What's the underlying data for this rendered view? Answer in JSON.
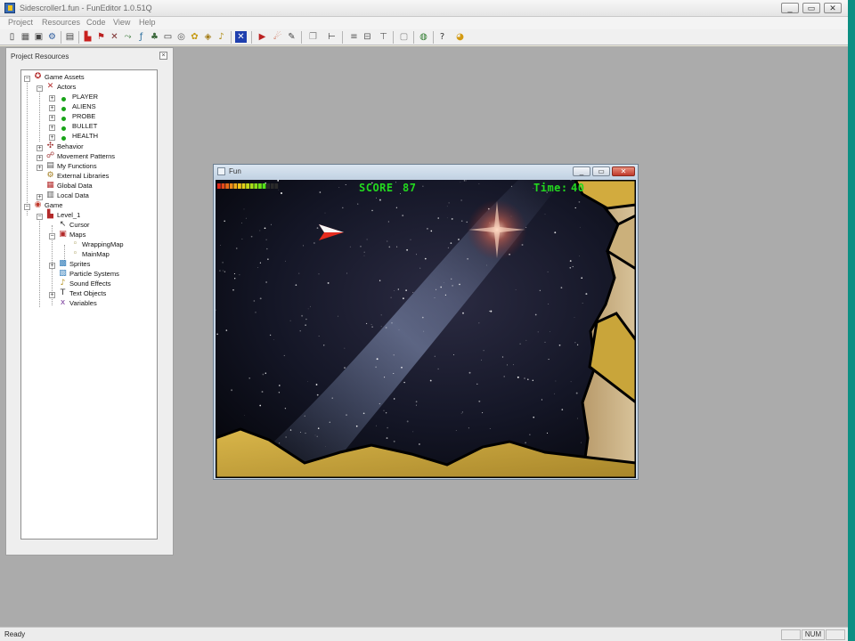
{
  "window": {
    "title": "Sidescroller1.fun - FunEditor 1.0.51Q",
    "buttons": {
      "minimize": "_",
      "maximize": "▭",
      "close": "✕"
    }
  },
  "menu": [
    "Project",
    "Resources",
    "Code",
    "View",
    "Help"
  ],
  "panel": {
    "title": "Project Resources",
    "close_symbol": "×",
    "tree": {
      "game_assets": "Game Assets",
      "actors": "Actors",
      "actor_items": [
        "PLAYER",
        "ALIENS",
        "PROBE",
        "BULLET",
        "HEALTH"
      ],
      "behavior": "Behavior",
      "movement_patterns": "Movement Patterns",
      "my_functions": "My Functions",
      "external_libraries": "External Libraries",
      "global_data": "Global Data",
      "local_data": "Local Data",
      "game": "Game",
      "level": "Level_1",
      "cursor": "Cursor",
      "maps": "Maps",
      "map_items": [
        "WrappingMap",
        "MainMap"
      ],
      "sprites": "Sprites",
      "particle_systems": "Particle Systems",
      "sound_effects": "Sound Effects",
      "text_objects": "Text Objects",
      "variables": "Variables"
    }
  },
  "game_window": {
    "title": "Fun",
    "hud": {
      "score_label": "SCORE",
      "score_value": "87",
      "time_label": "Time:",
      "time_value": "40",
      "health_fraction": 0.8
    },
    "colors": {
      "hud_text": "#23d81f",
      "rock": "#c9a53a",
      "space": "#0b0d1c"
    }
  },
  "status": {
    "text": "Ready",
    "num": "NUM"
  }
}
